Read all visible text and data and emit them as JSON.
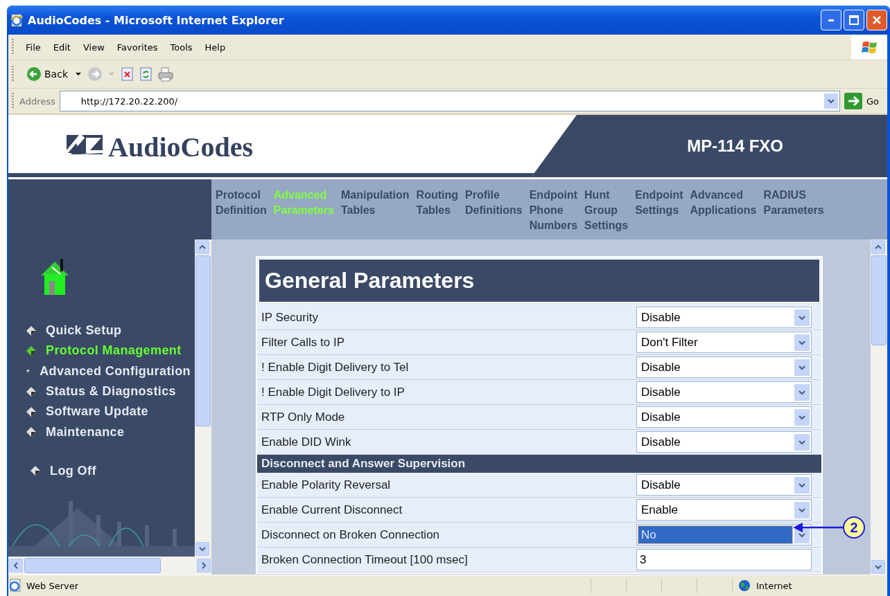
{
  "window": {
    "title": "AudioCodes - Microsoft Internet Explorer"
  },
  "menu_bar": [
    "File",
    "Edit",
    "View",
    "Favorites",
    "Tools",
    "Help"
  ],
  "toolbar": {
    "back_label": "Back"
  },
  "address_bar": {
    "label": "Address",
    "url": "http://172.20.22.200/",
    "go_label": "Go"
  },
  "header": {
    "logo": "AudioCodes",
    "product": "MP-114 FXO"
  },
  "nav_tabs": [
    {
      "lines": [
        "Protocol",
        "Definition"
      ],
      "selected": false
    },
    {
      "lines": [
        "Advanced",
        "Parameters"
      ],
      "selected": true
    },
    {
      "lines": [
        "Manipulation",
        "Tables"
      ],
      "selected": false
    },
    {
      "lines": [
        "Routing",
        "Tables"
      ],
      "selected": false
    },
    {
      "lines": [
        "Profile",
        "Definitions"
      ],
      "selected": false
    },
    {
      "lines": [
        "Endpoint",
        "Phone",
        "Numbers"
      ],
      "selected": false
    },
    {
      "lines": [
        "Hunt",
        "Group",
        "Settings"
      ],
      "selected": false
    },
    {
      "lines": [
        "Endpoint",
        "Settings"
      ],
      "selected": false
    },
    {
      "lines": [
        "Advanced",
        "Applications"
      ],
      "selected": false
    },
    {
      "lines": [
        "RADIUS",
        "Parameters"
      ],
      "selected": false
    }
  ],
  "sidebar": {
    "items": [
      {
        "label": "Quick Setup",
        "selected": false
      },
      {
        "label": "Protocol Management",
        "selected": true
      },
      {
        "label": "Advanced Configuration",
        "selected": false
      },
      {
        "label": "Status & Diagnostics",
        "selected": false
      },
      {
        "label": "Software Update",
        "selected": false
      },
      {
        "label": "Maintenance",
        "selected": false
      }
    ],
    "log_off": "Log Off"
  },
  "panel": {
    "title": "General Parameters",
    "rows": [
      {
        "kind": "select",
        "label": "IP Security",
        "value": "Disable",
        "focused": false
      },
      {
        "kind": "select",
        "label": "Filter Calls to IP",
        "value": "Don't Filter",
        "focused": false
      },
      {
        "kind": "select",
        "label": "! Enable Digit Delivery to Tel",
        "value": "Disable",
        "focused": false
      },
      {
        "kind": "select",
        "label": "! Enable Digit Delivery to IP",
        "value": "Disable",
        "focused": false
      },
      {
        "kind": "select",
        "label": "RTP Only Mode",
        "value": "Disable",
        "focused": false
      },
      {
        "kind": "select",
        "label": "Enable DID Wink",
        "value": "Disable",
        "focused": false
      },
      {
        "kind": "section",
        "label": "Disconnect and Answer Supervision"
      },
      {
        "kind": "select",
        "label": "Enable Polarity Reversal",
        "value": "Disable",
        "focused": false
      },
      {
        "kind": "select",
        "label": "Enable Current Disconnect",
        "value": "Enable",
        "focused": false
      },
      {
        "kind": "select",
        "label": "Disconnect on Broken Connection",
        "value": "No",
        "focused": true
      },
      {
        "kind": "text",
        "label": "Broken Connection Timeout [100 msec]",
        "value": "3"
      }
    ]
  },
  "callout": {
    "label": "2"
  },
  "status_bar": {
    "text": "Web Server",
    "zone": "Internet"
  }
}
